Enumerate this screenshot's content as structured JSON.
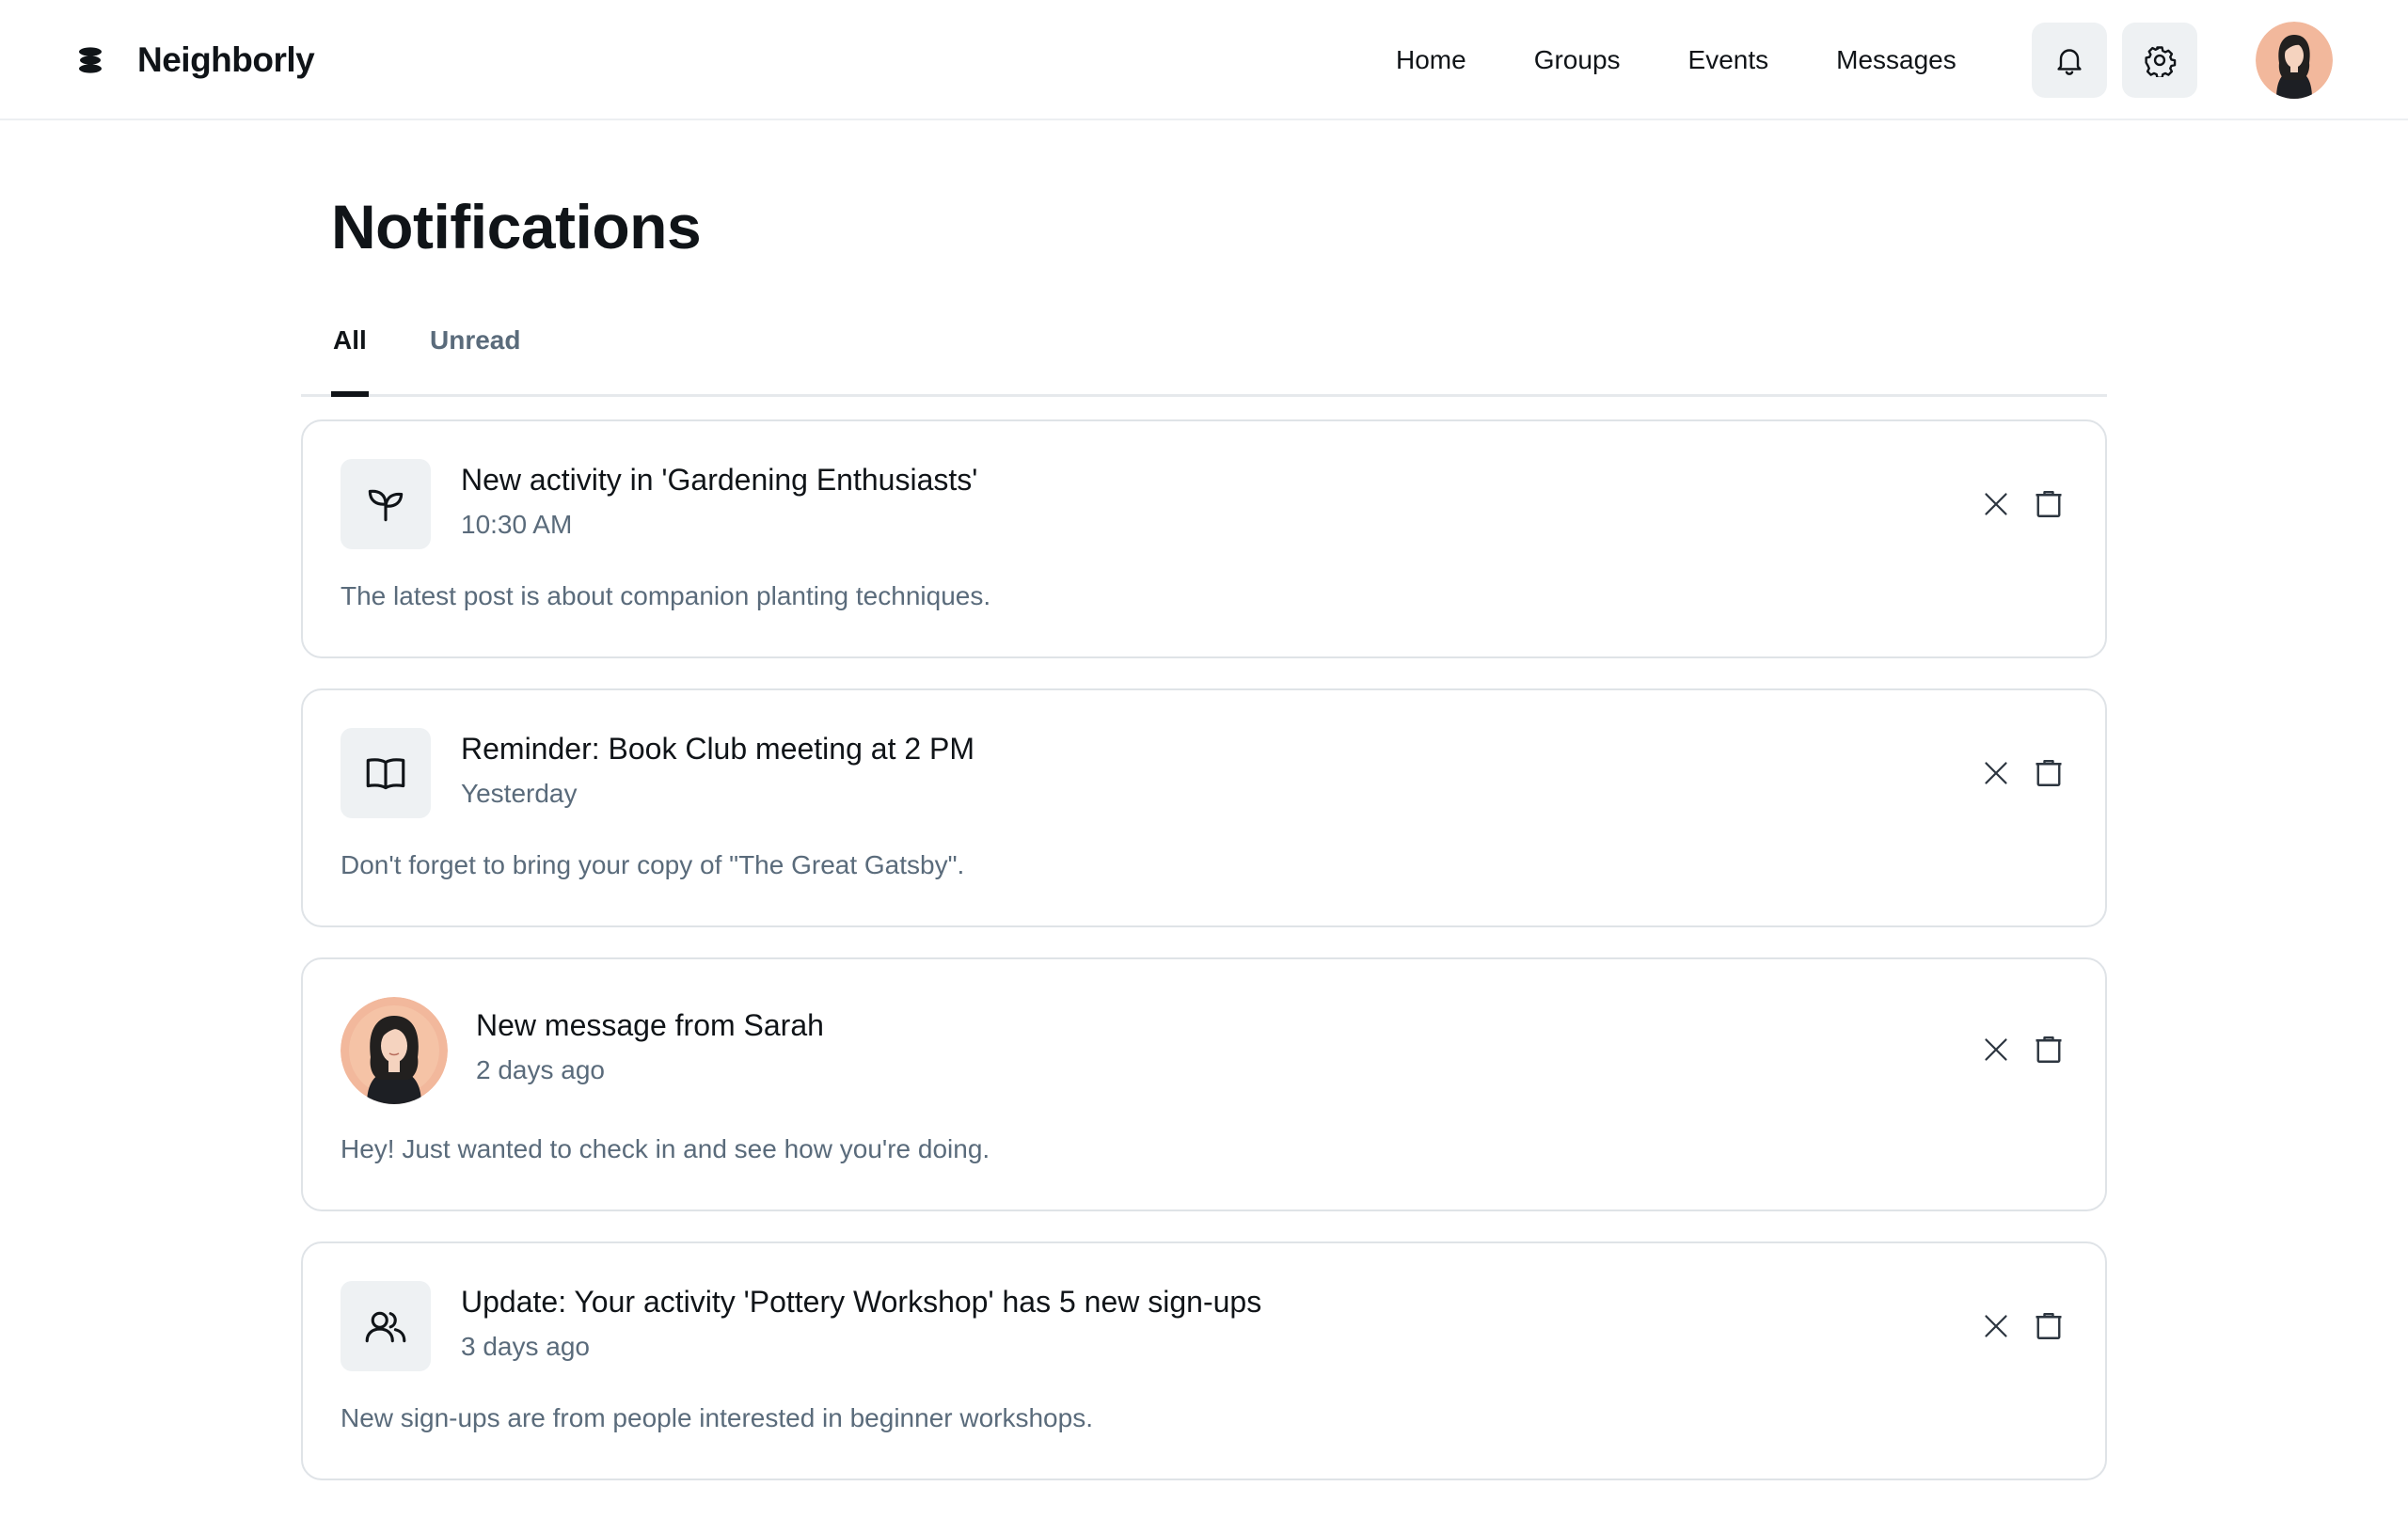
{
  "header": {
    "brand_name": "Neighborly",
    "nav": [
      "Home",
      "Groups",
      "Events",
      "Messages"
    ]
  },
  "page": {
    "title": "Notifications"
  },
  "tabs": [
    {
      "label": "All",
      "active": true
    },
    {
      "label": "Unread",
      "active": false
    }
  ],
  "notifications": [
    {
      "icon": "sprout-icon",
      "title": "New activity in 'Gardening Enthusiasts'",
      "time": "10:30 AM",
      "body": "The latest post is about companion planting techniques."
    },
    {
      "icon": "book-icon",
      "title": "Reminder: Book Club meeting at 2 PM",
      "time": "Yesterday",
      "body": "Don't forget to bring your copy of \"The Great Gatsby\"."
    },
    {
      "icon": "avatar-sarah",
      "title": "New message from Sarah",
      "time": "2 days ago",
      "body": "Hey! Just wanted to check in and see how you're doing."
    },
    {
      "icon": "users-icon",
      "title": "Update: Your activity 'Pottery Workshop' has 5 new sign-ups",
      "time": "3 days ago",
      "body": "New sign-ups are from people interested in beginner workshops."
    }
  ],
  "colors": {
    "text_primary": "#101418",
    "text_secondary": "#5a6b7b",
    "icon_bg": "#eef1f3",
    "card_border": "#dfe3e7",
    "avatar_bg": "#f2b89c"
  }
}
